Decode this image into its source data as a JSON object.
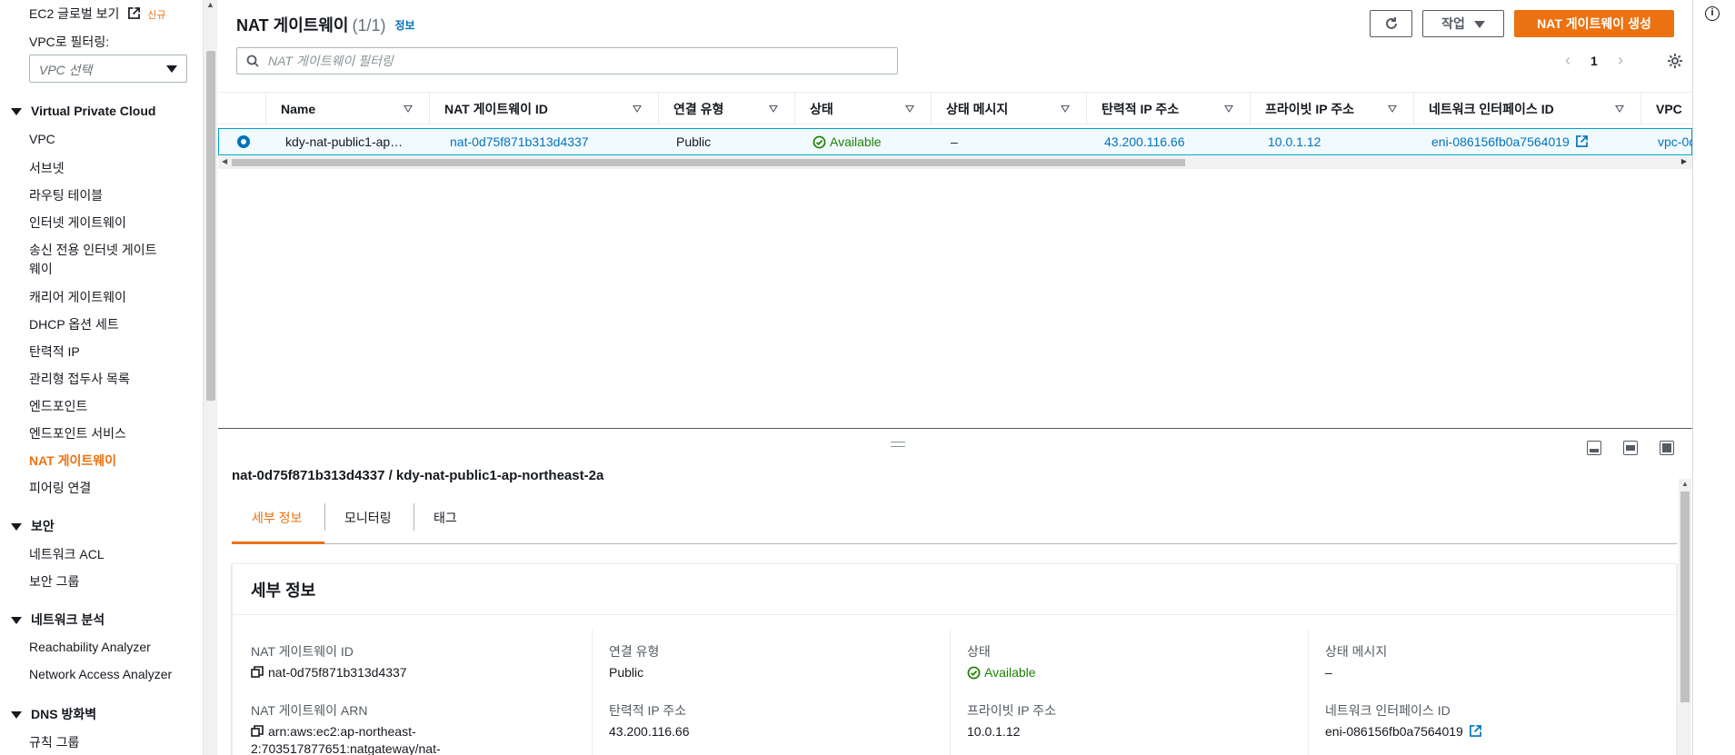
{
  "sidebar": {
    "ec2_global_view": "EC2 글로벌 보기",
    "new_badge": "신규",
    "vpc_filter_label": "VPC로 필터링:",
    "vpc_select_placeholder": "VPC 선택",
    "sections": {
      "vpc": "Virtual Private Cloud",
      "security": "보안",
      "network_analysis": "네트워크 분석",
      "dns_firewall": "DNS 방화벽"
    },
    "vpc_items": [
      "VPC",
      "서브넷",
      "라우팅 테이블",
      "인터넷 게이트웨이",
      "송신 전용 인터넷 게이트",
      "웨이",
      "캐리어 게이트웨이",
      "DHCP 옵션 세트",
      "탄력적 IP",
      "관리형 접두사 목록",
      "엔드포인트",
      "엔드포인트 서비스",
      "NAT 게이트웨이",
      "피어링 연결"
    ],
    "security_items": [
      "네트워크 ACL",
      "보안 그룹"
    ],
    "analysis_items": [
      "Reachability Analyzer",
      "Network Access Analyzer"
    ],
    "dns_items": [
      "규칙 그룹"
    ]
  },
  "header": {
    "title": "NAT 게이트웨이",
    "count": "(1/1)",
    "info_link": "정보",
    "actions_label": "작업",
    "create_label": "NAT 게이트웨이 생성",
    "filter_placeholder": "NAT 게이트웨이 필터링",
    "page_number": "1"
  },
  "table": {
    "columns": [
      "Name",
      "NAT 게이트웨이 ID",
      "연결 유형",
      "상태",
      "상태 메시지",
      "탄력적 IP 주소",
      "프라이빗 IP 주소",
      "네트워크 인터페이스 ID",
      "VPC"
    ],
    "rows": [
      {
        "name": "kdy-nat-public1-ap…",
        "nat_id": "nat-0d75f871b313d4337",
        "connectivity": "Public",
        "state": "Available",
        "state_message": "–",
        "elastic_ip": "43.200.116.66",
        "private_ip": "10.0.1.12",
        "eni": "eni-086156fb0a7564019",
        "vpc": "vpc-0c"
      }
    ]
  },
  "details": {
    "title": "nat-0d75f871b313d4337 / kdy-nat-public1-ap-northeast-2a",
    "tabs": [
      "세부 정보",
      "모니터링",
      "태그"
    ],
    "card_title": "세부 정보",
    "fields": {
      "nat_id_label": "NAT 게이트웨이 ID",
      "nat_id": "nat-0d75f871b313d4337",
      "nat_arn_label": "NAT 게이트웨이 ARN",
      "nat_arn_line1": "arn:aws:ec2:ap-northeast-",
      "nat_arn_line2": "2:703517877651:natgateway/nat-",
      "connectivity_label": "연결 유형",
      "connectivity": "Public",
      "elastic_ip_label": "탄력적 IP 주소",
      "elastic_ip": "43.200.116.66",
      "state_label": "상태",
      "state": "Available",
      "private_ip_label": "프라이빗 IP 주소",
      "private_ip": "10.0.1.12",
      "state_message_label": "상태 메시지",
      "state_message": "–",
      "eni_label": "네트워크 인터페이스 ID",
      "eni": "eni-086156fb0a7564019"
    }
  },
  "colors": {
    "accent": "#ec7211",
    "link": "#0073bb",
    "success": "#1d8102"
  }
}
